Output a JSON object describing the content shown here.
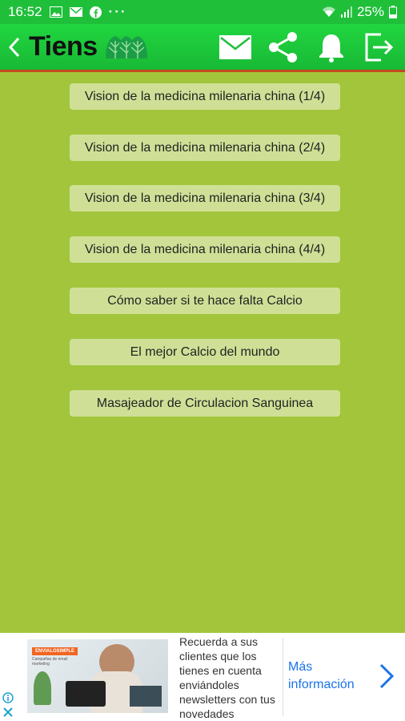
{
  "status": {
    "time": "16:52",
    "battery": "25%",
    "overflow": "···",
    "icons": [
      "image-icon",
      "email-icon",
      "facebook-icon",
      "wifi-icon",
      "signal-icon",
      "battery-icon"
    ]
  },
  "appbar": {
    "logo_text": "Tiens",
    "icons": [
      "back-icon",
      "mail-icon",
      "share-icon",
      "bell-icon",
      "exit-icon"
    ]
  },
  "items": [
    {
      "label": "Vision de la medicina milenaria china (1/4)"
    },
    {
      "label": "Vision de la medicina milenaria china (2/4)"
    },
    {
      "label": "Vision de la medicina milenaria china (3/4)"
    },
    {
      "label": "Vision de la medicina milenaria china (4/4)"
    },
    {
      "label": "Cómo saber si te hace falta Calcio"
    },
    {
      "label": "El mejor Calcio del mundo"
    },
    {
      "label": "Masajeador de Circulacion Sanguinea"
    }
  ],
  "ad": {
    "tag": "ENVIALOSIMPLE",
    "tag_sub": "Campañas de email marketing",
    "text": "Recuerda a sus clientes que los tienes en cuenta enviándoles newsletters con tus novedades",
    "cta": "Más información"
  },
  "colors": {
    "statusbar": "#1fbf3a",
    "appbar": "#21d640",
    "appbar_border": "#c24a1e",
    "background": "#a2c53b",
    "item_bg": "#cfe096",
    "cta": "#1a73e8"
  }
}
